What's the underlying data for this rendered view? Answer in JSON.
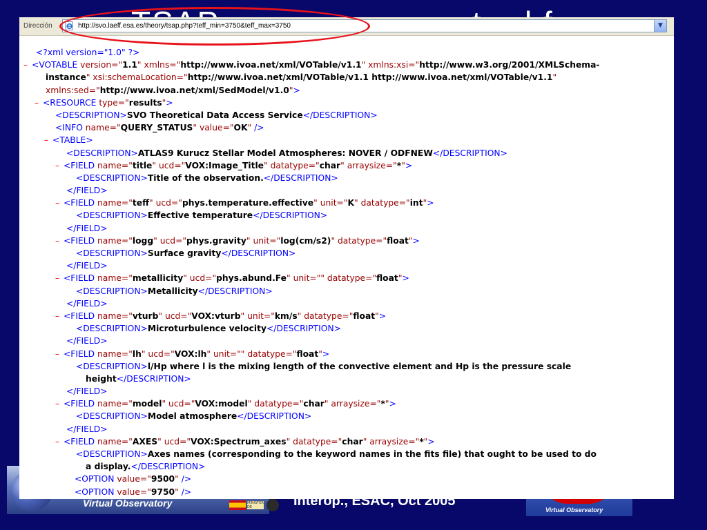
{
  "slide": {
    "title_fragments": [
      "TSAP",
      "t",
      "l f"
    ],
    "footer_center": "Interop., ESAC, Oct 2005",
    "footer_left_caption": "Virtual Observatory",
    "footer_left_ministry": "MINISTERIO DE EDUCACIÓN Y CIENCIA",
    "footer_left_inta": "INTA",
    "footer_right_caption": "Virtual Observatory"
  },
  "browser": {
    "address_label": "Dirección",
    "url": "http://svo.laeff.esa.es/theory/tsap.php?teff_min=3750&teff_max=3750"
  },
  "xml_lines": [
    {
      "indent": 24,
      "marker": "",
      "parts": [
        [
          "t",
          "<?xml version=\"1.0\" ?>"
        ]
      ]
    },
    {
      "indent": 6,
      "marker": "–",
      "parts": [
        [
          "t",
          "<"
        ],
        [
          "t",
          "VOTABLE "
        ],
        [
          "a",
          "version=\""
        ],
        [
          "v",
          "1.1"
        ],
        [
          "a",
          "\" xmlns=\""
        ],
        [
          "v",
          "http://www.ivoa.net/xml/VOTable/v1.1"
        ],
        [
          "a",
          "\" xmlns:xsi=\""
        ],
        [
          "v",
          "http://www.w3.org/2001/XMLSchema-"
        ]
      ]
    },
    {
      "indent": 38,
      "marker": "",
      "parts": [
        [
          "v",
          "instance"
        ],
        [
          "a",
          "\" xsi:schemaLocation=\""
        ],
        [
          "v",
          "http://www.ivoa.net/xml/VOTable/v1.1 http://www.ivoa.net/xml/VOTable/v1.1"
        ],
        [
          "a",
          "\""
        ]
      ]
    },
    {
      "indent": 38,
      "marker": "",
      "parts": [
        [
          "a",
          "xmlns:sed=\""
        ],
        [
          "v",
          "http://www.ivoa.net/xml/SedModel/v1.0"
        ],
        [
          "a",
          "\""
        ],
        [
          "t",
          ">"
        ]
      ]
    },
    {
      "indent": 22,
      "marker": "–",
      "parts": [
        [
          "t",
          "<RESOURCE "
        ],
        [
          "a",
          "type=\""
        ],
        [
          "v",
          "results"
        ],
        [
          "a",
          "\""
        ],
        [
          "t",
          ">"
        ]
      ]
    },
    {
      "indent": 52,
      "marker": "",
      "parts": [
        [
          "t",
          "<DESCRIPTION>"
        ],
        [
          "txt",
          "SVO Theoretical Data Access Service"
        ],
        [
          "t",
          "</DESCRIPTION>"
        ]
      ]
    },
    {
      "indent": 52,
      "marker": "",
      "parts": [
        [
          "t",
          "<INFO "
        ],
        [
          "a",
          "name=\""
        ],
        [
          "v",
          "QUERY_STATUS"
        ],
        [
          "a",
          "\" value=\""
        ],
        [
          "v",
          "OK"
        ],
        [
          "a",
          "\""
        ],
        [
          "t",
          " />"
        ]
      ]
    },
    {
      "indent": 36,
      "marker": "–",
      "parts": [
        [
          "t",
          "<TABLE>"
        ]
      ]
    },
    {
      "indent": 68,
      "marker": "",
      "parts": [
        [
          "t",
          "<DESCRIPTION>"
        ],
        [
          "txt",
          "ATLAS9 Kurucz Stellar Model Atmospheres: NOVER / ODFNEW"
        ],
        [
          "t",
          "</DESCRIPTION>"
        ]
      ]
    },
    {
      "indent": 52,
      "marker": "–",
      "parts": [
        [
          "t",
          "<FIELD "
        ],
        [
          "a",
          "name=\""
        ],
        [
          "v",
          "title"
        ],
        [
          "a",
          "\" ucd=\""
        ],
        [
          "v",
          "VOX:Image_Title"
        ],
        [
          "a",
          "\" datatype=\""
        ],
        [
          "v",
          "char"
        ],
        [
          "a",
          "\" arraysize=\""
        ],
        [
          "v",
          "*"
        ],
        [
          "a",
          "\""
        ],
        [
          "t",
          ">"
        ]
      ]
    },
    {
      "indent": 82,
      "marker": "",
      "parts": [
        [
          "t",
          "<DESCRIPTION>"
        ],
        [
          "txt",
          "Title of the observation."
        ],
        [
          "t",
          "</DESCRIPTION>"
        ]
      ]
    },
    {
      "indent": 68,
      "marker": "",
      "parts": [
        [
          "t",
          "</FIELD>"
        ]
      ]
    },
    {
      "indent": 52,
      "marker": "–",
      "parts": [
        [
          "t",
          "<FIELD "
        ],
        [
          "a",
          "name=\""
        ],
        [
          "v",
          "teff"
        ],
        [
          "a",
          "\" ucd=\""
        ],
        [
          "v",
          "phys.temperature.effective"
        ],
        [
          "a",
          "\" unit=\""
        ],
        [
          "v",
          "K"
        ],
        [
          "a",
          "\" datatype=\""
        ],
        [
          "v",
          "int"
        ],
        [
          "a",
          "\""
        ],
        [
          "t",
          ">"
        ]
      ]
    },
    {
      "indent": 82,
      "marker": "",
      "parts": [
        [
          "t",
          "<DESCRIPTION>"
        ],
        [
          "txt",
          "Effective temperature"
        ],
        [
          "t",
          "</DESCRIPTION>"
        ]
      ]
    },
    {
      "indent": 68,
      "marker": "",
      "parts": [
        [
          "t",
          "</FIELD>"
        ]
      ]
    },
    {
      "indent": 52,
      "marker": "–",
      "parts": [
        [
          "t",
          "<FIELD "
        ],
        [
          "a",
          "name=\""
        ],
        [
          "v",
          "logg"
        ],
        [
          "a",
          "\" ucd=\""
        ],
        [
          "v",
          "phys.gravity"
        ],
        [
          "a",
          "\" unit=\""
        ],
        [
          "v",
          "log(cm/s2)"
        ],
        [
          "a",
          "\" datatype=\""
        ],
        [
          "v",
          "float"
        ],
        [
          "a",
          "\""
        ],
        [
          "t",
          ">"
        ]
      ]
    },
    {
      "indent": 82,
      "marker": "",
      "parts": [
        [
          "t",
          "<DESCRIPTION>"
        ],
        [
          "txt",
          "Surface gravity"
        ],
        [
          "t",
          "</DESCRIPTION>"
        ]
      ]
    },
    {
      "indent": 68,
      "marker": "",
      "parts": [
        [
          "t",
          "</FIELD>"
        ]
      ]
    },
    {
      "indent": 52,
      "marker": "–",
      "parts": [
        [
          "t",
          "<FIELD "
        ],
        [
          "a",
          "name=\""
        ],
        [
          "v",
          "metallicity"
        ],
        [
          "a",
          "\" ucd=\""
        ],
        [
          "v",
          "phys.abund.Fe"
        ],
        [
          "a",
          "\" unit=\"\" datatype=\""
        ],
        [
          "v",
          "float"
        ],
        [
          "a",
          "\""
        ],
        [
          "t",
          ">"
        ]
      ]
    },
    {
      "indent": 82,
      "marker": "",
      "parts": [
        [
          "t",
          "<DESCRIPTION>"
        ],
        [
          "txt",
          "Metallicity"
        ],
        [
          "t",
          "</DESCRIPTION>"
        ]
      ]
    },
    {
      "indent": 68,
      "marker": "",
      "parts": [
        [
          "t",
          "</FIELD>"
        ]
      ]
    },
    {
      "indent": 52,
      "marker": "–",
      "parts": [
        [
          "t",
          "<FIELD "
        ],
        [
          "a",
          "name=\""
        ],
        [
          "v",
          "vturb"
        ],
        [
          "a",
          "\" ucd=\""
        ],
        [
          "v",
          "VOX:vturb"
        ],
        [
          "a",
          "\" unit=\""
        ],
        [
          "v",
          "km/s"
        ],
        [
          "a",
          "\" datatype=\""
        ],
        [
          "v",
          "float"
        ],
        [
          "a",
          "\""
        ],
        [
          "t",
          ">"
        ]
      ]
    },
    {
      "indent": 82,
      "marker": "",
      "parts": [
        [
          "t",
          "<DESCRIPTION>"
        ],
        [
          "txt",
          "Microturbulence velocity"
        ],
        [
          "t",
          "</DESCRIPTION>"
        ]
      ]
    },
    {
      "indent": 68,
      "marker": "",
      "parts": [
        [
          "t",
          "</FIELD>"
        ]
      ]
    },
    {
      "indent": 52,
      "marker": "–",
      "parts": [
        [
          "t",
          "<FIELD "
        ],
        [
          "a",
          "name=\""
        ],
        [
          "v",
          "lh"
        ],
        [
          "a",
          "\" ucd=\""
        ],
        [
          "v",
          "VOX:lh"
        ],
        [
          "a",
          "\" unit=\"\" datatype=\""
        ],
        [
          "v",
          "float"
        ],
        [
          "a",
          "\""
        ],
        [
          "t",
          ">"
        ]
      ]
    },
    {
      "indent": 82,
      "marker": "",
      "parts": [
        [
          "t",
          "<DESCRIPTION>"
        ],
        [
          "txt",
          "l/Hp where l is the mixing length of the convective element and Hp is the pressure scale"
        ]
      ]
    },
    {
      "indent": 96,
      "marker": "",
      "parts": [
        [
          "txt",
          "height"
        ],
        [
          "t",
          "</DESCRIPTION>"
        ]
      ]
    },
    {
      "indent": 68,
      "marker": "",
      "parts": [
        [
          "t",
          "</FIELD>"
        ]
      ]
    },
    {
      "indent": 52,
      "marker": "–",
      "parts": [
        [
          "t",
          "<FIELD "
        ],
        [
          "a",
          "name=\""
        ],
        [
          "v",
          "model"
        ],
        [
          "a",
          "\" ucd=\""
        ],
        [
          "v",
          "VOX:model"
        ],
        [
          "a",
          "\" datatype=\""
        ],
        [
          "v",
          "char"
        ],
        [
          "a",
          "\" arraysize=\""
        ],
        [
          "v",
          "*"
        ],
        [
          "a",
          "\""
        ],
        [
          "t",
          ">"
        ]
      ]
    },
    {
      "indent": 82,
      "marker": "",
      "parts": [
        [
          "t",
          "<DESCRIPTION>"
        ],
        [
          "txt",
          "Model atmosphere"
        ],
        [
          "t",
          "</DESCRIPTION>"
        ]
      ]
    },
    {
      "indent": 68,
      "marker": "",
      "parts": [
        [
          "t",
          "</FIELD>"
        ]
      ]
    },
    {
      "indent": 52,
      "marker": "–",
      "parts": [
        [
          "t",
          "<FIELD "
        ],
        [
          "a",
          "name=\""
        ],
        [
          "v",
          "AXES"
        ],
        [
          "a",
          "\" ucd=\""
        ],
        [
          "v",
          "VOX:Spectrum_axes"
        ],
        [
          "a",
          "\" datatype=\""
        ],
        [
          "v",
          "char"
        ],
        [
          "a",
          "\" arraysize=\""
        ],
        [
          "v",
          "*"
        ],
        [
          "a",
          "\""
        ],
        [
          "t",
          ">"
        ]
      ]
    },
    {
      "indent": 82,
      "marker": "",
      "parts": [
        [
          "t",
          "<DESCRIPTION>"
        ],
        [
          "txt",
          "Axes names (corresponding to the keyword names in the fits file) that ought to be used to do"
        ]
      ]
    },
    {
      "indent": 96,
      "marker": "",
      "parts": [
        [
          "txt",
          "a display."
        ],
        [
          "t",
          "</DESCRIPTION>"
        ]
      ]
    },
    {
      "indent": 80,
      "marker": "",
      "parts": [
        [
          "t",
          "<OPTION "
        ],
        [
          "a",
          "value=\""
        ],
        [
          "v",
          "9500"
        ],
        [
          "a",
          "\""
        ],
        [
          "t",
          " />"
        ]
      ]
    },
    {
      "indent": 80,
      "marker": "",
      "parts": [
        [
          "t",
          "<OPTION "
        ],
        [
          "a",
          "value=\""
        ],
        [
          "v",
          "9750"
        ],
        [
          "a",
          "\""
        ],
        [
          "t",
          " />"
        ]
      ]
    }
  ]
}
